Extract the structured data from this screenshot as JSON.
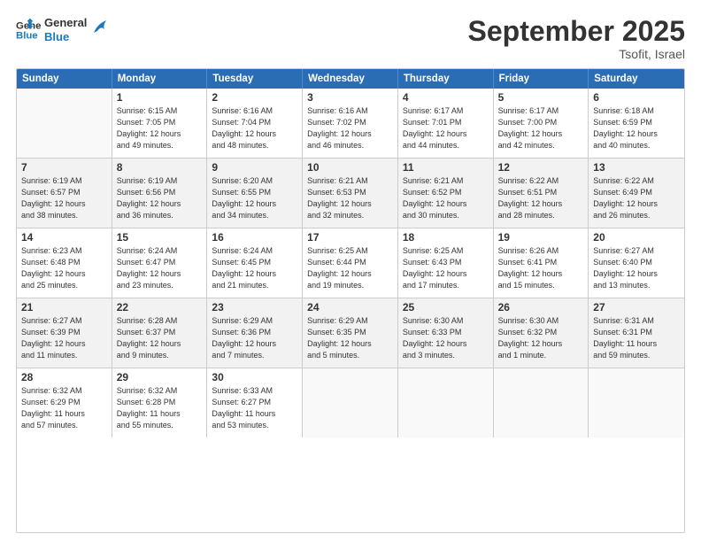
{
  "header": {
    "logo_line1": "General",
    "logo_line2": "Blue",
    "month": "September 2025",
    "location": "Tsofit, Israel"
  },
  "days_of_week": [
    "Sunday",
    "Monday",
    "Tuesday",
    "Wednesday",
    "Thursday",
    "Friday",
    "Saturday"
  ],
  "weeks": [
    [
      {
        "day": "",
        "text": ""
      },
      {
        "day": "1",
        "text": "Sunrise: 6:15 AM\nSunset: 7:05 PM\nDaylight: 12 hours\nand 49 minutes."
      },
      {
        "day": "2",
        "text": "Sunrise: 6:16 AM\nSunset: 7:04 PM\nDaylight: 12 hours\nand 48 minutes."
      },
      {
        "day": "3",
        "text": "Sunrise: 6:16 AM\nSunset: 7:02 PM\nDaylight: 12 hours\nand 46 minutes."
      },
      {
        "day": "4",
        "text": "Sunrise: 6:17 AM\nSunset: 7:01 PM\nDaylight: 12 hours\nand 44 minutes."
      },
      {
        "day": "5",
        "text": "Sunrise: 6:17 AM\nSunset: 7:00 PM\nDaylight: 12 hours\nand 42 minutes."
      },
      {
        "day": "6",
        "text": "Sunrise: 6:18 AM\nSunset: 6:59 PM\nDaylight: 12 hours\nand 40 minutes."
      }
    ],
    [
      {
        "day": "7",
        "text": "Sunrise: 6:19 AM\nSunset: 6:57 PM\nDaylight: 12 hours\nand 38 minutes."
      },
      {
        "day": "8",
        "text": "Sunrise: 6:19 AM\nSunset: 6:56 PM\nDaylight: 12 hours\nand 36 minutes."
      },
      {
        "day": "9",
        "text": "Sunrise: 6:20 AM\nSunset: 6:55 PM\nDaylight: 12 hours\nand 34 minutes."
      },
      {
        "day": "10",
        "text": "Sunrise: 6:21 AM\nSunset: 6:53 PM\nDaylight: 12 hours\nand 32 minutes."
      },
      {
        "day": "11",
        "text": "Sunrise: 6:21 AM\nSunset: 6:52 PM\nDaylight: 12 hours\nand 30 minutes."
      },
      {
        "day": "12",
        "text": "Sunrise: 6:22 AM\nSunset: 6:51 PM\nDaylight: 12 hours\nand 28 minutes."
      },
      {
        "day": "13",
        "text": "Sunrise: 6:22 AM\nSunset: 6:49 PM\nDaylight: 12 hours\nand 26 minutes."
      }
    ],
    [
      {
        "day": "14",
        "text": "Sunrise: 6:23 AM\nSunset: 6:48 PM\nDaylight: 12 hours\nand 25 minutes."
      },
      {
        "day": "15",
        "text": "Sunrise: 6:24 AM\nSunset: 6:47 PM\nDaylight: 12 hours\nand 23 minutes."
      },
      {
        "day": "16",
        "text": "Sunrise: 6:24 AM\nSunset: 6:45 PM\nDaylight: 12 hours\nand 21 minutes."
      },
      {
        "day": "17",
        "text": "Sunrise: 6:25 AM\nSunset: 6:44 PM\nDaylight: 12 hours\nand 19 minutes."
      },
      {
        "day": "18",
        "text": "Sunrise: 6:25 AM\nSunset: 6:43 PM\nDaylight: 12 hours\nand 17 minutes."
      },
      {
        "day": "19",
        "text": "Sunrise: 6:26 AM\nSunset: 6:41 PM\nDaylight: 12 hours\nand 15 minutes."
      },
      {
        "day": "20",
        "text": "Sunrise: 6:27 AM\nSunset: 6:40 PM\nDaylight: 12 hours\nand 13 minutes."
      }
    ],
    [
      {
        "day": "21",
        "text": "Sunrise: 6:27 AM\nSunset: 6:39 PM\nDaylight: 12 hours\nand 11 minutes."
      },
      {
        "day": "22",
        "text": "Sunrise: 6:28 AM\nSunset: 6:37 PM\nDaylight: 12 hours\nand 9 minutes."
      },
      {
        "day": "23",
        "text": "Sunrise: 6:29 AM\nSunset: 6:36 PM\nDaylight: 12 hours\nand 7 minutes."
      },
      {
        "day": "24",
        "text": "Sunrise: 6:29 AM\nSunset: 6:35 PM\nDaylight: 12 hours\nand 5 minutes."
      },
      {
        "day": "25",
        "text": "Sunrise: 6:30 AM\nSunset: 6:33 PM\nDaylight: 12 hours\nand 3 minutes."
      },
      {
        "day": "26",
        "text": "Sunrise: 6:30 AM\nSunset: 6:32 PM\nDaylight: 12 hours\nand 1 minute."
      },
      {
        "day": "27",
        "text": "Sunrise: 6:31 AM\nSunset: 6:31 PM\nDaylight: 11 hours\nand 59 minutes."
      }
    ],
    [
      {
        "day": "28",
        "text": "Sunrise: 6:32 AM\nSunset: 6:29 PM\nDaylight: 11 hours\nand 57 minutes."
      },
      {
        "day": "29",
        "text": "Sunrise: 6:32 AM\nSunset: 6:28 PM\nDaylight: 11 hours\nand 55 minutes."
      },
      {
        "day": "30",
        "text": "Sunrise: 6:33 AM\nSunset: 6:27 PM\nDaylight: 11 hours\nand 53 minutes."
      },
      {
        "day": "",
        "text": ""
      },
      {
        "day": "",
        "text": ""
      },
      {
        "day": "",
        "text": ""
      },
      {
        "day": "",
        "text": ""
      }
    ]
  ]
}
